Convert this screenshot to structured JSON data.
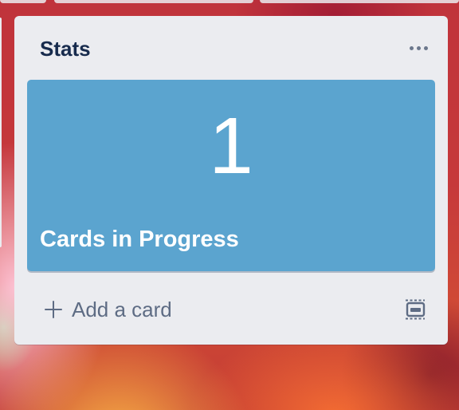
{
  "list": {
    "title": "Stats",
    "menu_icon": "more-horizontal-icon",
    "card": {
      "value": "1",
      "label": "Cards in Progress",
      "background_color": "#5ba4cf"
    },
    "footer": {
      "add_card_label": "Add a card",
      "add_icon": "plus-icon",
      "template_icon": "card-template-icon"
    }
  }
}
